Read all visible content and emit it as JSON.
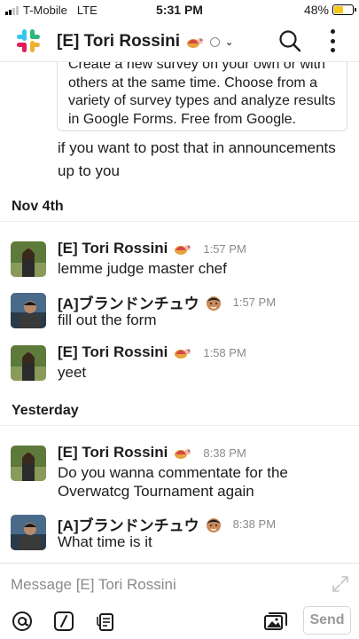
{
  "status_bar": {
    "carrier": "T-Mobile",
    "network": "LTE",
    "time": "5:31 PM",
    "battery": "48%",
    "battery_level": 0.48
  },
  "header": {
    "title": "[E] Tori Rossini",
    "status_icon": "turtle-emoji",
    "presence": "away"
  },
  "messages": {
    "preview_card_text": "Create a new survey on your own or with others at the same time. Choose from a variety of survey types and analyze results in Google Forms. Free from Google.",
    "continuation_text": "if you want to post that in announcements up to you",
    "dates": {
      "nov4": "Nov 4th",
      "yesterday": "Yesterday"
    },
    "items": [
      {
        "author": "[E] Tori Rossini",
        "time": "1:57 PM",
        "text": "lemme judge master chef",
        "status_icon": "turtle-emoji"
      },
      {
        "author": "[A]ブランドンチュウ",
        "time": "1:57 PM",
        "text": "fill out the form",
        "status_icon": "face-emoji"
      },
      {
        "author": "[E] Tori Rossini",
        "time": "1:58 PM",
        "text": "yeet",
        "status_icon": "turtle-emoji"
      },
      {
        "author": "[E] Tori Rossini",
        "time": "8:38 PM",
        "text": "Do you wanna commentate for the Overwatcg Tournament again",
        "status_icon": "turtle-emoji"
      },
      {
        "author": "[A]ブランドンチュウ",
        "time": "8:38 PM",
        "text": "What time is it",
        "status_icon": "face-emoji"
      }
    ]
  },
  "composer": {
    "placeholder": "Message [E] Tori Rossini",
    "send_label": "Send"
  }
}
